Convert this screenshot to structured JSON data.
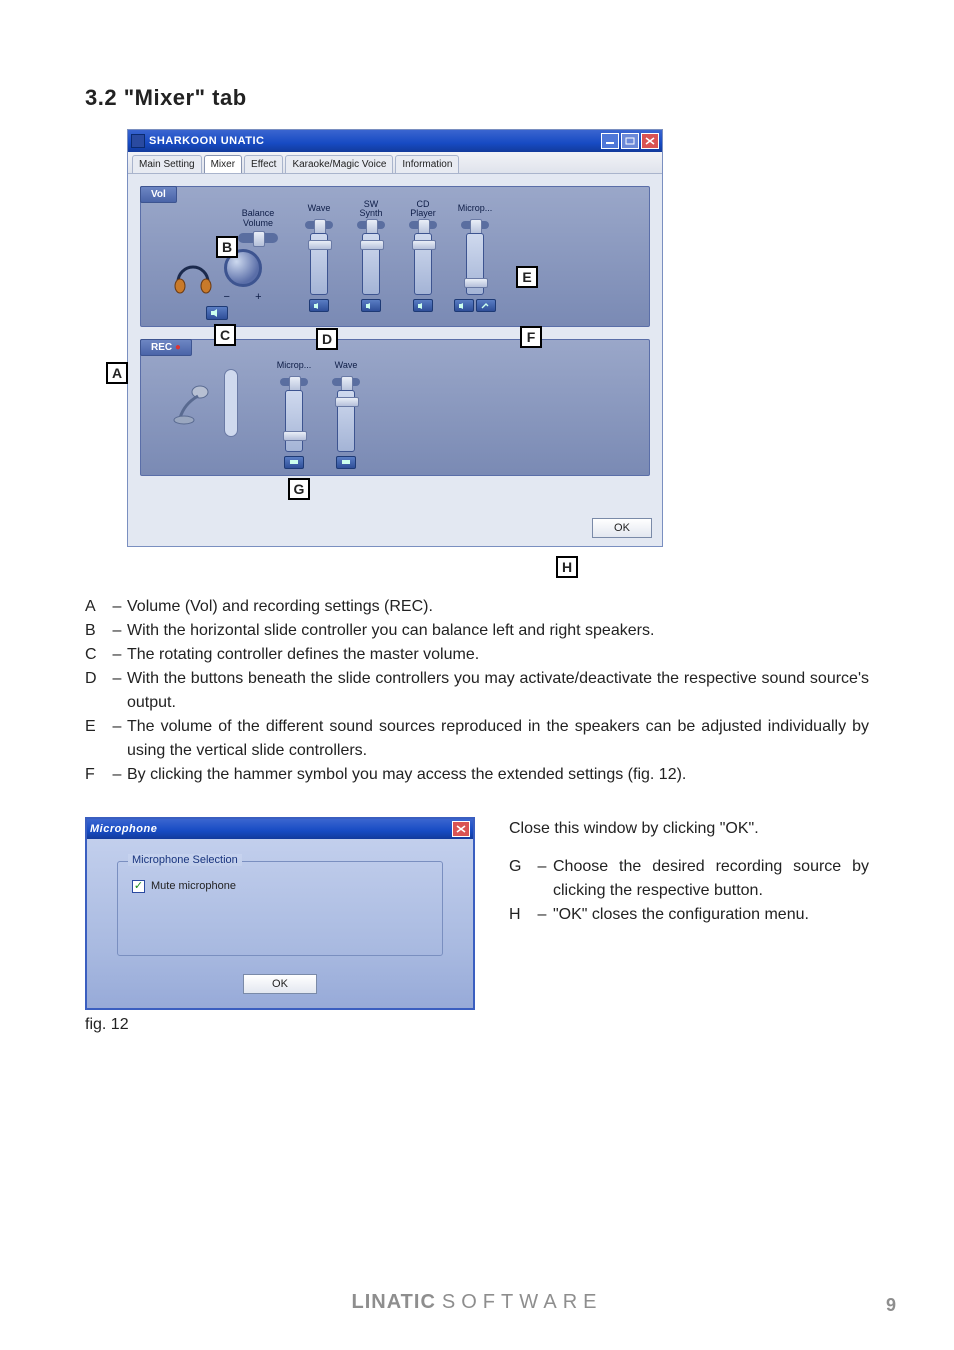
{
  "heading": "3.2  \"Mixer\" tab",
  "appwin": {
    "title": "SHARKOON UNATIC",
    "tabs": [
      "Main Setting",
      "Mixer",
      "Effect",
      "Karaoke/Magic Voice",
      "Information"
    ],
    "active_tab": 1,
    "vol_panel": {
      "header": "Vol",
      "balance_label": "Balance\nVolume",
      "channels": [
        {
          "label": "Wave",
          "thumb": 6
        },
        {
          "label": "SW\nSynth",
          "thumb": 6
        },
        {
          "label": "CD\nPlayer",
          "thumb": 6
        },
        {
          "label": "Microp...",
          "thumb": 44,
          "extra": true
        }
      ]
    },
    "rec_panel": {
      "header": "REC",
      "channels": [
        {
          "label": "Microp...",
          "thumb": 40
        },
        {
          "label": "Wave",
          "thumb": 6
        }
      ]
    },
    "ok_label": "OK"
  },
  "callouts": [
    "A",
    "B",
    "C",
    "D",
    "E",
    "F",
    "G",
    "H"
  ],
  "legend": [
    {
      "k": "A",
      "d": "Volume (Vol) and recording settings (REC)."
    },
    {
      "k": "B",
      "d": "With the horizontal slide controller you can balance left and right speakers."
    },
    {
      "k": "C",
      "d": "The rotating controller defines the master volume."
    },
    {
      "k": "D",
      "d": "With the buttons beneath the slide controllers you may activate/deactivate the respective sound source's output."
    },
    {
      "k": "E",
      "d": "The volume of the different sound sources reproduced in the speakers can be adjusted individually by using the vertical slide controllers."
    },
    {
      "k": "F",
      "d": "By clicking the hammer symbol you may access the extended settings (fig. 12)."
    }
  ],
  "mic_dialog": {
    "title": "Microphone",
    "group_label": "Microphone Selection",
    "checkbox_label": "Mute microphone",
    "ok_label": "OK"
  },
  "right_notes": {
    "intro": "Close this window by clicking \"OK\".",
    "items": [
      {
        "k": "G",
        "d": "Choose the desired recording source by clicking the respective button."
      },
      {
        "k": "H",
        "d": "\"OK\" closes the configuration menu."
      }
    ]
  },
  "fig_caption": "fig. 12",
  "footer": {
    "brand_bold": "LINATIC",
    "brand_thin": "SOFTWARE",
    "page": "9"
  }
}
